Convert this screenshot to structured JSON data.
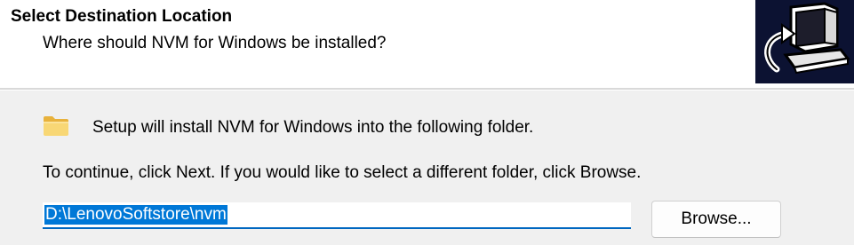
{
  "header": {
    "title": "Select Destination Location",
    "subtitle": "Where should NVM for Windows be installed?",
    "logo_icon": "computer-install-icon"
  },
  "body": {
    "folder_icon": "folder-icon",
    "intro": "Setup will install NVM for Windows into the following folder.",
    "instruction": "To continue, click Next. If you would like to select a different folder, click Browse.",
    "path_value": "D:\\LenovoSoftstore\\nvm",
    "browse_label": "Browse..."
  },
  "colors": {
    "header_background": "#ffffff",
    "body_background": "#f0f0f0",
    "logo_background": "#0c1232",
    "selection_highlight": "#0078d7",
    "input_focus_underline": "#0067c0",
    "folder": "#f4cc5c"
  }
}
